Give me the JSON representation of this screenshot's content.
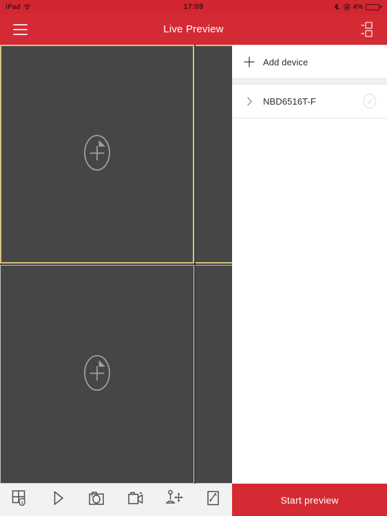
{
  "status_bar": {
    "carrier": "iPad",
    "wifi_icon": "wifi-icon",
    "time": "17:09",
    "moon_icon": "moon-icon",
    "rotation_lock_icon": "rotation-lock-icon",
    "battery_percent": "4%",
    "battery_icon": "battery-charging-icon"
  },
  "header": {
    "menu_icon": "hamburger-menu-icon",
    "title": "Live Preview",
    "split_icon": "window-split-icon",
    "background_color": "#d42a34"
  },
  "video_grid": {
    "cells": [
      {
        "name": "channel-cell-1",
        "selected": true,
        "placeholder_icon": "add-camera-icon"
      },
      {
        "name": "channel-cell-2",
        "selected": true,
        "placeholder_icon": "none"
      },
      {
        "name": "channel-cell-3",
        "selected": false,
        "placeholder_icon": "add-camera-icon"
      },
      {
        "name": "channel-cell-4",
        "selected": false,
        "placeholder_icon": "none"
      }
    ],
    "selected_border_color": "#ddc37f",
    "cell_background": "#464646",
    "area_background": "#3f3f3f"
  },
  "device_panel": {
    "add_device": {
      "label": "Add device",
      "icon": "plus-icon"
    },
    "devices": [
      {
        "name": "NBD6516T-F",
        "expand_icon": "chevron-right-icon",
        "select_icon": "check-circle-icon",
        "selected": false
      }
    ]
  },
  "toolbar": {
    "items": [
      {
        "name": "split-layout-button",
        "icon": "grid-4-split-icon",
        "badge": "4"
      },
      {
        "name": "play-button",
        "icon": "play-icon"
      },
      {
        "name": "snapshot-button",
        "icon": "camera-icon"
      },
      {
        "name": "record-button",
        "icon": "video-record-icon"
      },
      {
        "name": "ptz-button",
        "icon": "ptz-joystick-icon"
      },
      {
        "name": "more-button",
        "icon": "edit-pen-icon"
      }
    ]
  },
  "start_preview": {
    "label": "Start preview",
    "background_color": "#d42a34"
  }
}
